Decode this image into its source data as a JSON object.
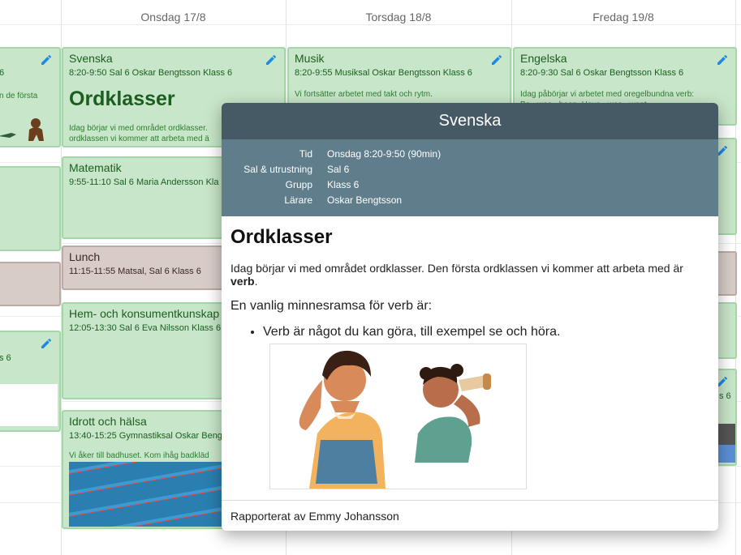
{
  "days": [
    "Onsdag 17/8",
    "Torsdag 18/8",
    "Fredag 19/8"
  ],
  "left_col": {
    "ev1_sub": "6",
    "ev1_desc": "n de första",
    "ev4_sub": "s 6"
  },
  "wednesday": {
    "svenska": {
      "title": "Svenska",
      "sub": "8:20-9:50 Sal 6 Oskar Bengtsson Klass 6",
      "big": "Ordklasser",
      "desc1": "Idag börjar vi med området ordklasser.",
      "desc2": "ordklassen vi kommer att arbeta med ä"
    },
    "matematik": {
      "title": "Matematik",
      "sub": "9:55-11:10 Sal 6 Maria Andersson  Kla"
    },
    "lunch": {
      "title": "Lunch",
      "sub": "11:15-11:55 Matsal, Sal 6  Klass 6"
    },
    "hem": {
      "title": "Hem- och konsumentkunskap",
      "sub": "12:05-13:30 Sal 6 Eva Nilsson  Klass 6"
    },
    "idrott": {
      "title": "Idrott och hälsa",
      "sub": "13:40-15:25 Gymnastiksal Oskar Beng",
      "desc": "Vi åker till badhuset. Kom ihåg badkläd"
    }
  },
  "thursday": {
    "musik": {
      "title": "Musik",
      "sub": "8:20-9:55 Musiksal Oskar Bengtsson Klass 6",
      "desc": "Vi fortsätter arbetet med takt och rytm."
    }
  },
  "friday": {
    "engelska": {
      "title": "Engelska",
      "sub": "8:20-9:30 Sal 6 Oskar Bengtsson Klass 6",
      "desc1": "Idag påbörjar vi arbetet med oregelbundna verb:",
      "desc2": "Be - was - been,  Have - was - went"
    },
    "ev5_sub": "s 6"
  },
  "popup": {
    "title": "Svenska",
    "info": [
      {
        "label": "Tid",
        "value": "Onsdag 8:20-9:50 (90min)"
      },
      {
        "label": "Sal & utrustning",
        "value": "Sal 6"
      },
      {
        "label": "Grupp",
        "value": "Klass 6"
      },
      {
        "label": "Lärare",
        "value": "Oskar Bengtsson"
      }
    ],
    "heading": "Ordklasser",
    "para1_pre": "Idag börjar vi med området ordklasser. Den första ordklassen vi kommer att arbeta med är ",
    "para1_bold": "verb",
    "para1_post": ".",
    "para2": "En vanlig minnesramsa för verb är:",
    "bullet": "Verb är något du kan göra, till exempel se och höra.",
    "footer": "Rapporterat av Emmy Johansson"
  },
  "colors": {
    "event_bg": "#c8e6c9",
    "event_border": "#a5d6a7",
    "lunch_bg": "#d7ccc8",
    "popup_header": "#455a64",
    "popup_info": "#607d8b",
    "pencil": "#1e88e5"
  }
}
